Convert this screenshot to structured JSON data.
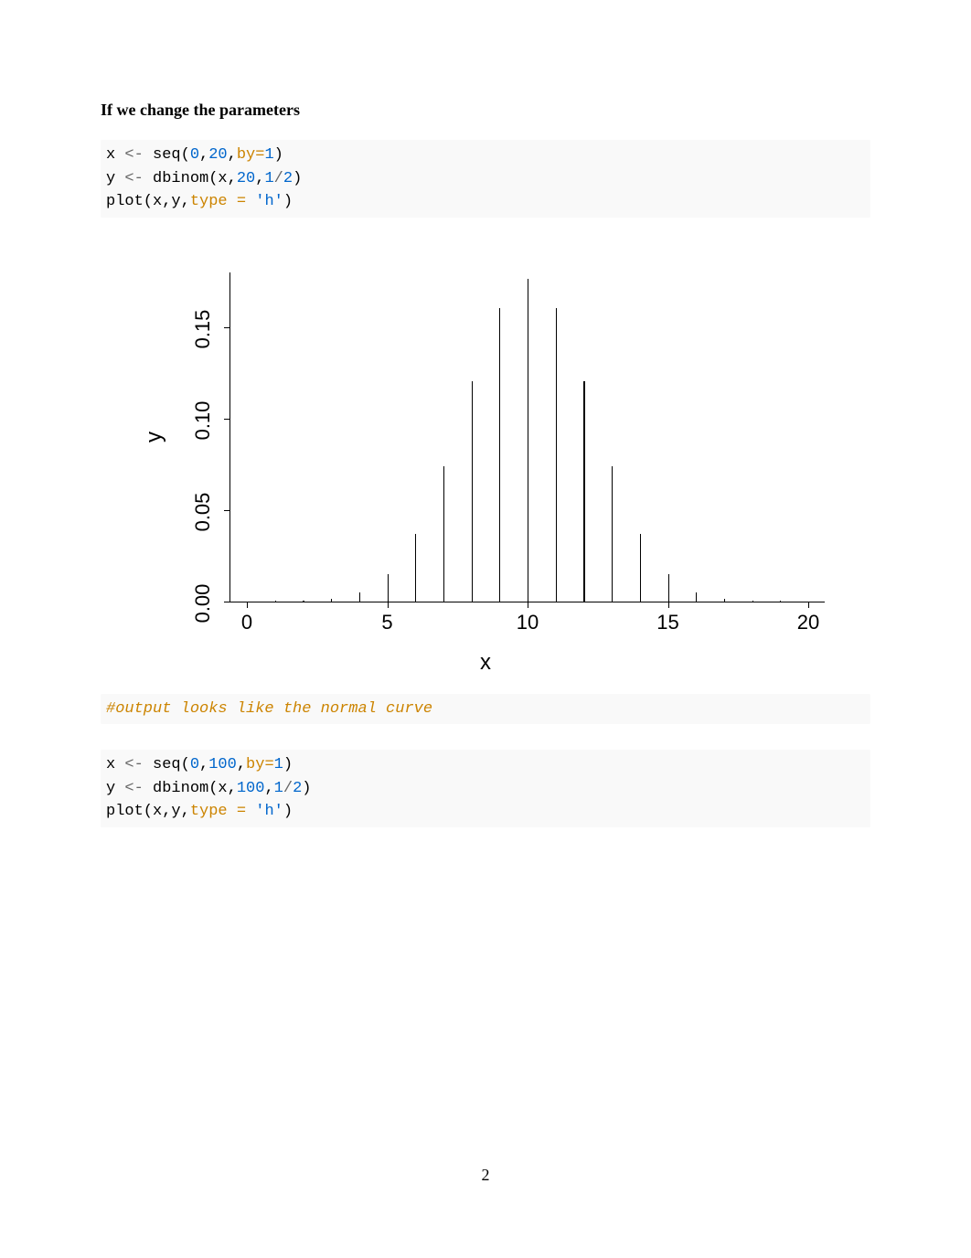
{
  "heading": "If we change the parameters",
  "code1": {
    "l1a": "x ",
    "l1op": "<-",
    "l1b": " seq(",
    "l1n1": "0",
    "l1c1": ",",
    "l1n2": "20",
    "l1c2": ",",
    "l1arg": "by=",
    "l1n3": "1",
    "l1end": ")",
    "l2a": "y ",
    "l2op": "<-",
    "l2b": " dbinom(x,",
    "l2n1": "20",
    "l2c1": ",",
    "l2n2": "1",
    "l2s": "/",
    "l2n3": "2",
    "l2end": ")",
    "l3a": "plot(x,y,",
    "l3arg": "type =",
    "l3sp": " ",
    "l3str": "'h'",
    "l3end": ")"
  },
  "comment_line": "#output looks like the normal curve",
  "code2": {
    "l1a": "x ",
    "l1op": "<-",
    "l1b": " seq(",
    "l1n1": "0",
    "l1c1": ",",
    "l1n2": "100",
    "l1c2": ",",
    "l1arg": "by=",
    "l1n3": "1",
    "l1end": ")",
    "l2a": "y ",
    "l2op": "<-",
    "l2b": " dbinom(x,",
    "l2n1": "100",
    "l2c1": ",",
    "l2n2": "1",
    "l2s": "/",
    "l2n3": "2",
    "l2end": ")",
    "l3a": "plot(x,y,",
    "l3arg": "type =",
    "l3sp": " ",
    "l3str": "'h'",
    "l3end": ")"
  },
  "chart_data": {
    "type": "bar",
    "title": "",
    "xlabel": "x",
    "ylabel": "y",
    "xlim": [
      0,
      20
    ],
    "ylim": [
      0,
      0.18
    ],
    "x_ticks": [
      0,
      5,
      10,
      15,
      20
    ],
    "y_ticks": [
      0.0,
      0.05,
      0.1,
      0.15
    ],
    "y_tick_labels": [
      "0.00",
      "0.05",
      "0.10",
      "0.15"
    ],
    "categories": [
      0,
      1,
      2,
      3,
      4,
      5,
      6,
      7,
      8,
      9,
      10,
      11,
      12,
      13,
      14,
      15,
      16,
      17,
      18,
      19,
      20
    ],
    "values": [
      9.5e-07,
      1.91e-05,
      0.000181,
      0.001087,
      0.004621,
      0.014786,
      0.036964,
      0.073929,
      0.120134,
      0.160179,
      0.176197,
      0.160179,
      0.120134,
      0.073929,
      0.036964,
      0.014786,
      0.004621,
      0.001087,
      0.000181,
      1.91e-05,
      9.5e-07
    ]
  },
  "page_number": "2"
}
